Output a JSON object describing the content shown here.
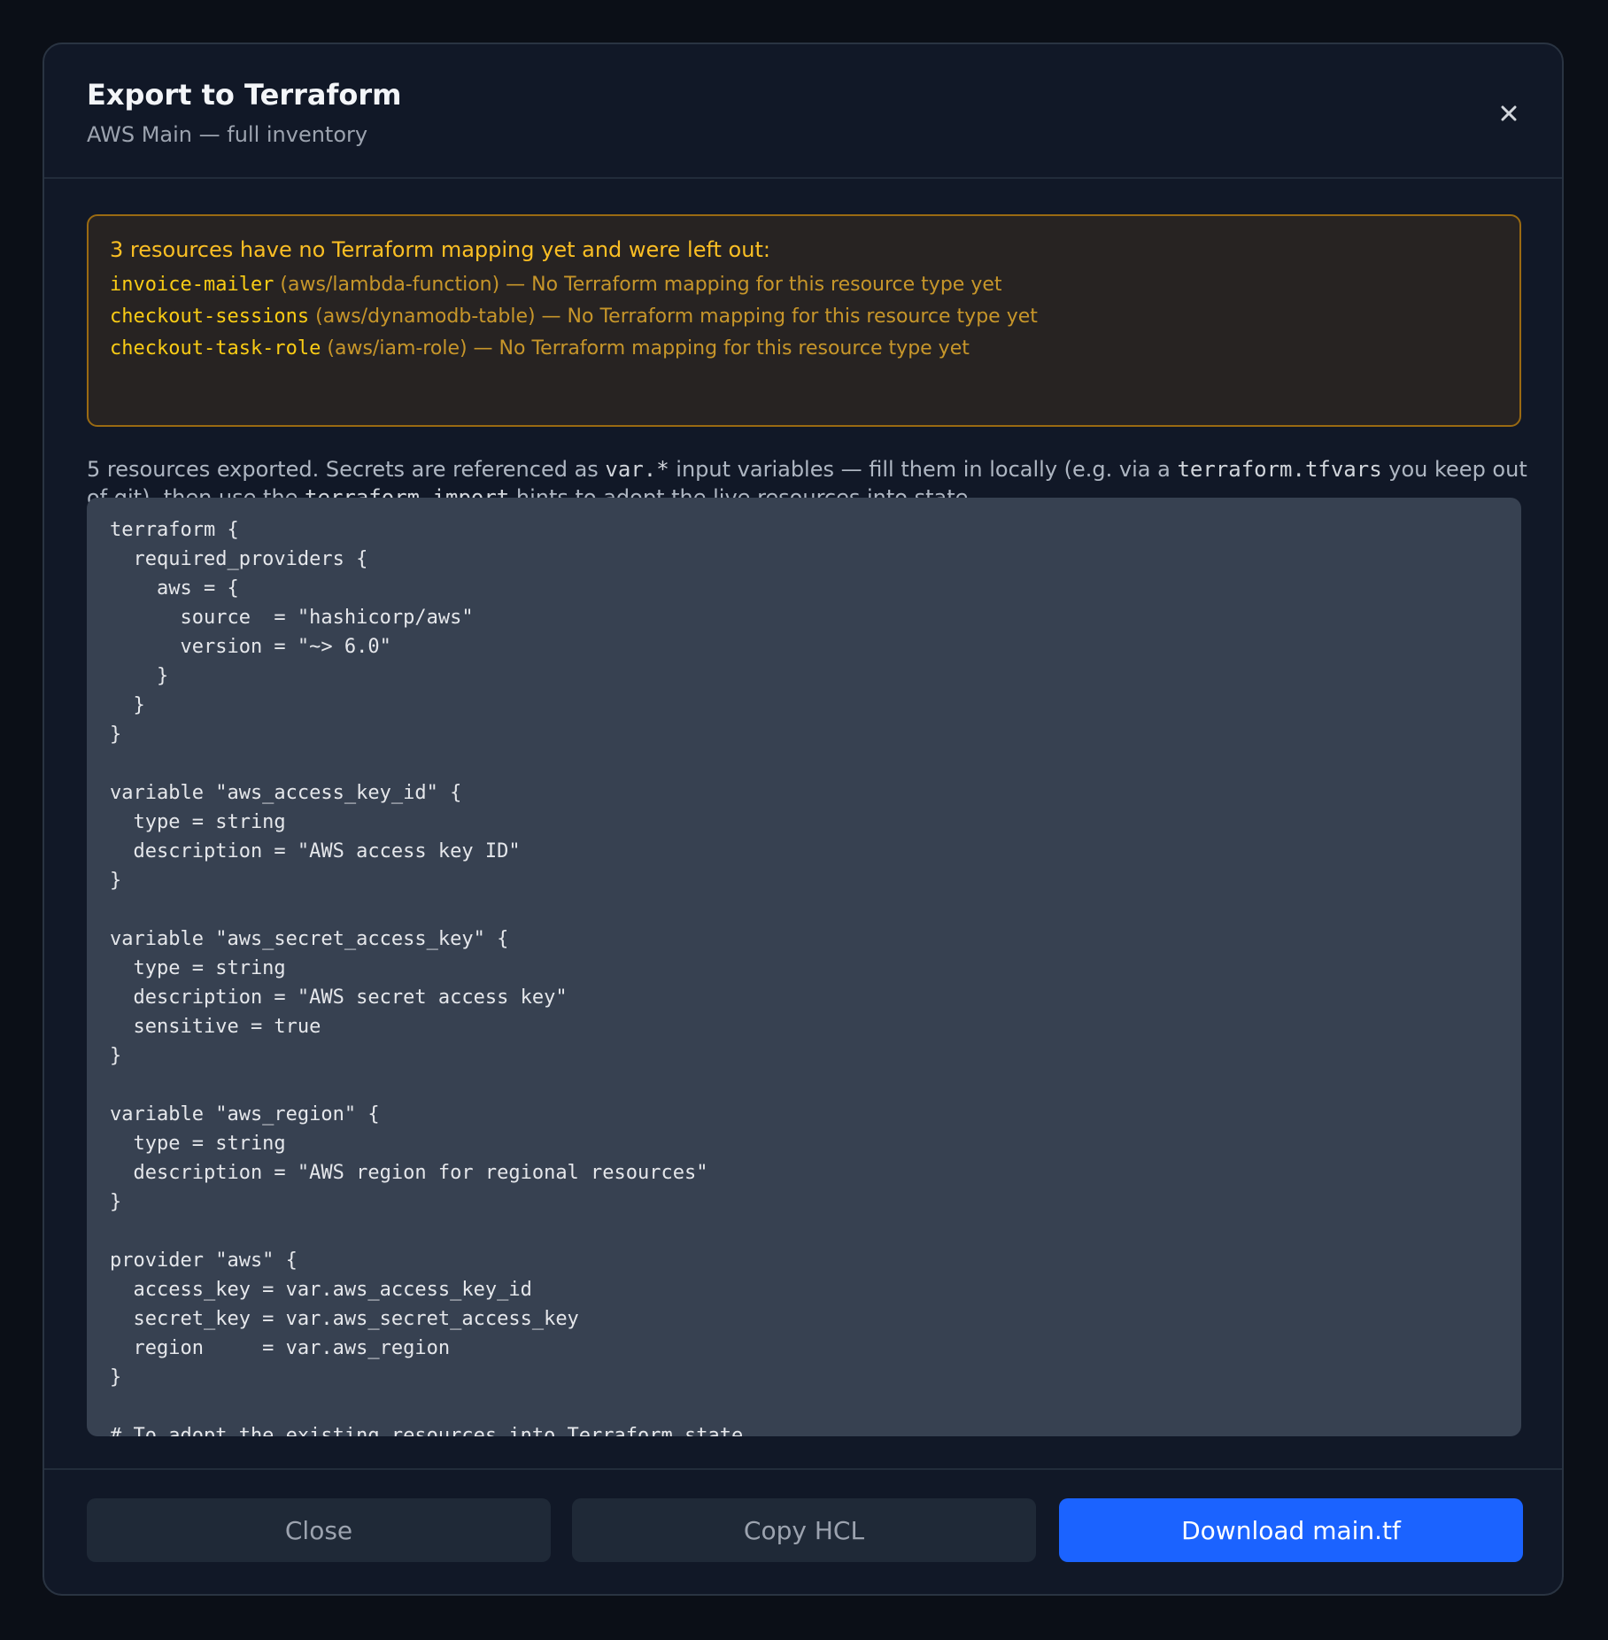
{
  "dialog": {
    "title": "Export to Terraform",
    "subtitle": "AWS Main — full inventory",
    "close_icon": "close-icon"
  },
  "warning": {
    "title": "3 resources have no Terraform mapping yet and were left out:",
    "items": [
      {
        "name": "invoice-mailer",
        "detail": " (aws/lambda-function) — No Terraform mapping for this resource type yet"
      },
      {
        "name": "checkout-sessions",
        "detail": " (aws/dynamodb-table) — No Terraform mapping for this resource type yet"
      },
      {
        "name": "checkout-task-role",
        "detail": " (aws/iam-role) — No Terraform mapping for this resource type yet"
      }
    ],
    "colors": {
      "accent": "#fbbf24",
      "border": "#9a6a12"
    }
  },
  "info": {
    "part1": "5 resources exported. Secrets are referenced as ",
    "code1": "var.*",
    "part2": " input variables — fill them in locally (e.g. via a ",
    "code2": "terraform.tfvars",
    "part3": " you keep out of git), then use the ",
    "code3": "terraform import",
    "part4": " hints to adopt the live resources into state."
  },
  "code": {
    "content": "terraform {\n  required_providers {\n    aws = {\n      source  = \"hashicorp/aws\"\n      version = \"~> 6.0\"\n    }\n  }\n}\n\nvariable \"aws_access_key_id\" {\n  type = string\n  description = \"AWS access key ID\"\n}\n\nvariable \"aws_secret_access_key\" {\n  type = string\n  description = \"AWS secret access key\"\n  sensitive = true\n}\n\nvariable \"aws_region\" {\n  type = string\n  description = \"AWS region for regional resources\"\n}\n\nprovider \"aws\" {\n  access_key = var.aws_access_key_id\n  secret_key = var.aws_secret_access_key\n  region     = var.aws_region\n}\n\n# To adopt the existing resources into Terraform state"
  },
  "footer": {
    "close_label": "Close",
    "copy_label": "Copy HCL",
    "download_label": "Download main.tf",
    "primary_color": "#1b63ff"
  }
}
